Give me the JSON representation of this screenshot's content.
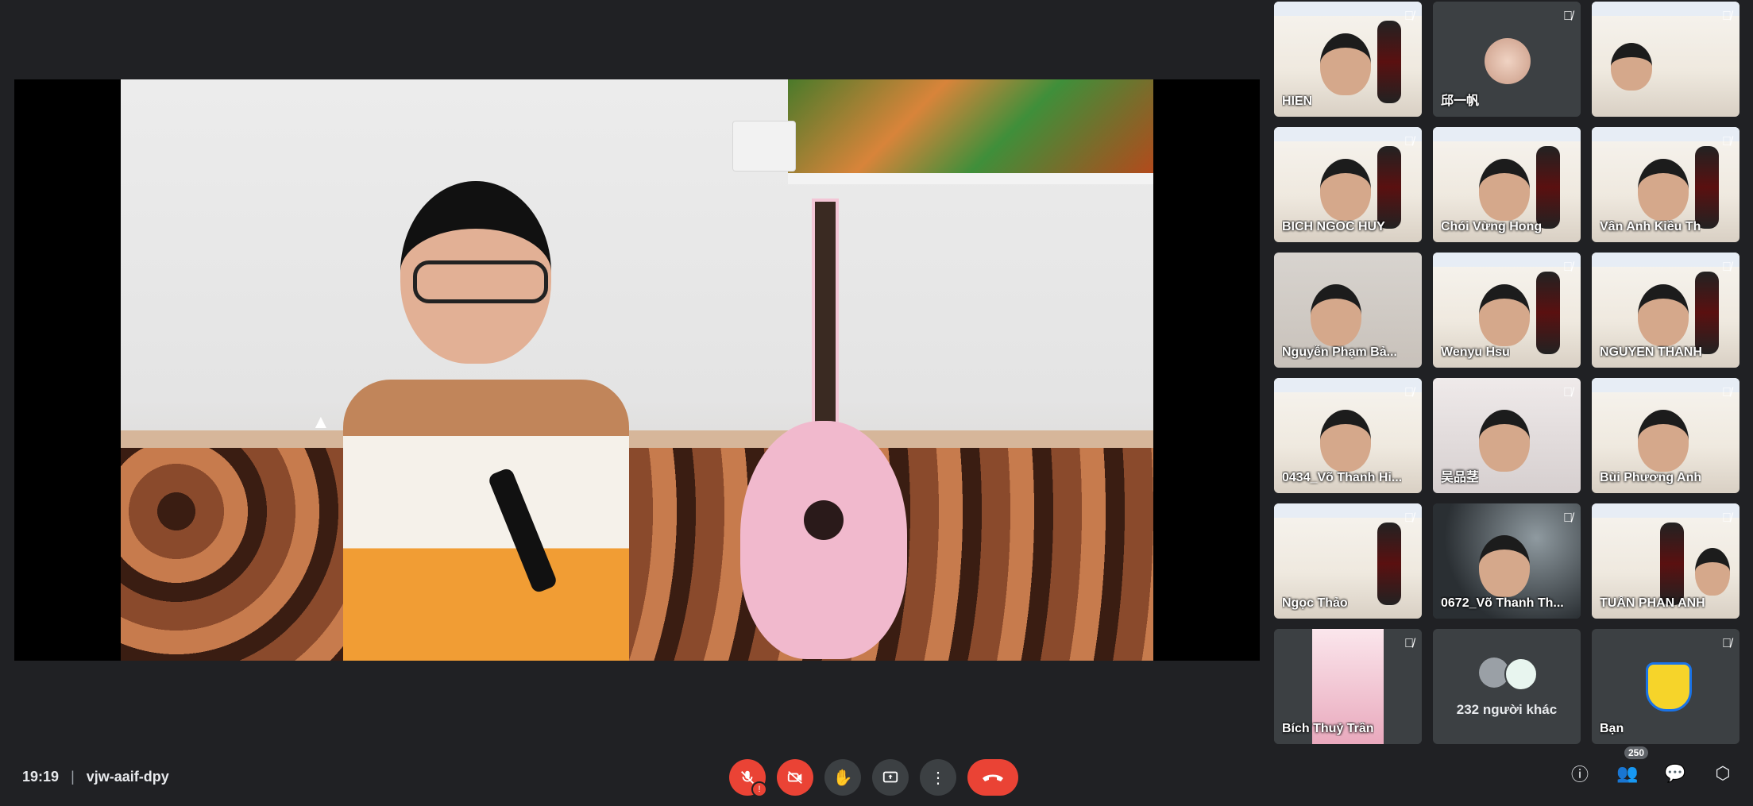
{
  "meeting": {
    "time": "19:19",
    "separator": "|",
    "code": "vjw-aaif-dpy"
  },
  "participants": [
    {
      "name": "HIEN",
      "muted": true
    },
    {
      "name": "邱一帆",
      "muted": true
    },
    {
      "name": "",
      "muted": true
    },
    {
      "name": "BICH NGOC HUY",
      "muted": true
    },
    {
      "name": "Chói Vừng Hong",
      "muted": false
    },
    {
      "name": "Vân Anh Kiều Th",
      "muted": true
    },
    {
      "name": "Nguyễn Phạm Bả...",
      "muted": false
    },
    {
      "name": "Wenyu Hsu",
      "muted": true
    },
    {
      "name": "NGUYEN THANH",
      "muted": true
    },
    {
      "name": "0434_Võ Thanh Hi...",
      "muted": true
    },
    {
      "name": "吴品茎",
      "muted": true
    },
    {
      "name": "Bùi Phương Anh",
      "muted": true
    },
    {
      "name": "Ngọc Thảo",
      "muted": true
    },
    {
      "name": "0672_Võ Thanh Th...",
      "muted": true
    },
    {
      "name": "TUẤN PHAN ANH",
      "muted": true
    },
    {
      "name": "Bích Thuỷ Trần",
      "muted": true
    }
  ],
  "others_label": "232 người khác",
  "self_label": "Bạn",
  "participant_count": "250",
  "colors": {
    "background": "#202124",
    "tile": "#3c4043",
    "danger": "#ea4335"
  }
}
